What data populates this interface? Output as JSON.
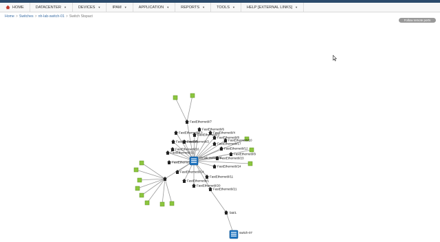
{
  "nav": {
    "items": [
      {
        "label": "HOME",
        "caret": false
      },
      {
        "label": "DATACENTER",
        "caret": true
      },
      {
        "label": "DEVICES",
        "caret": true
      },
      {
        "label": "IPAM",
        "caret": true
      },
      {
        "label": "APPLICATION",
        "caret": true
      },
      {
        "label": "REPORTS",
        "caret": true
      },
      {
        "label": "TOOLS",
        "caret": true
      },
      {
        "label": "HELP [EXTERNAL LINKS]",
        "caret": true
      }
    ]
  },
  "breadcrumb": {
    "home": "Home",
    "switches": "Switches",
    "device": "nh-lab-switch-01",
    "current": "Switch Stspact"
  },
  "follow_button": "Follow remote ports",
  "graph": {
    "main_switch": "nh-lab-switch-01",
    "port_labels": [
      "FastEthernet0/7",
      "FastEthernet0/6",
      "FastEthernet0/4",
      "FastEthernet0/13",
      "FastEthernet0/3",
      "FastEthernet0/8",
      "FastEthernet0/10",
      "FastEthernet0/17",
      "FastEthernet0/5",
      "FastEthernet0/2",
      "FastEthernet0/16",
      "FastEthernet0/15",
      "FastEthernet0/12",
      "FastEthernet0/9",
      "FastEthernet0/23",
      "FastEthernet0/24",
      "FastEthernet0/18",
      "FastEthernet0/14",
      "FastEthernet0/11",
      "FastEthernet0/1",
      "FastEthernet0/20",
      "FastEthernet0/21"
    ],
    "uplink_label": "fa0/1",
    "remote_switch": "switch-07"
  }
}
